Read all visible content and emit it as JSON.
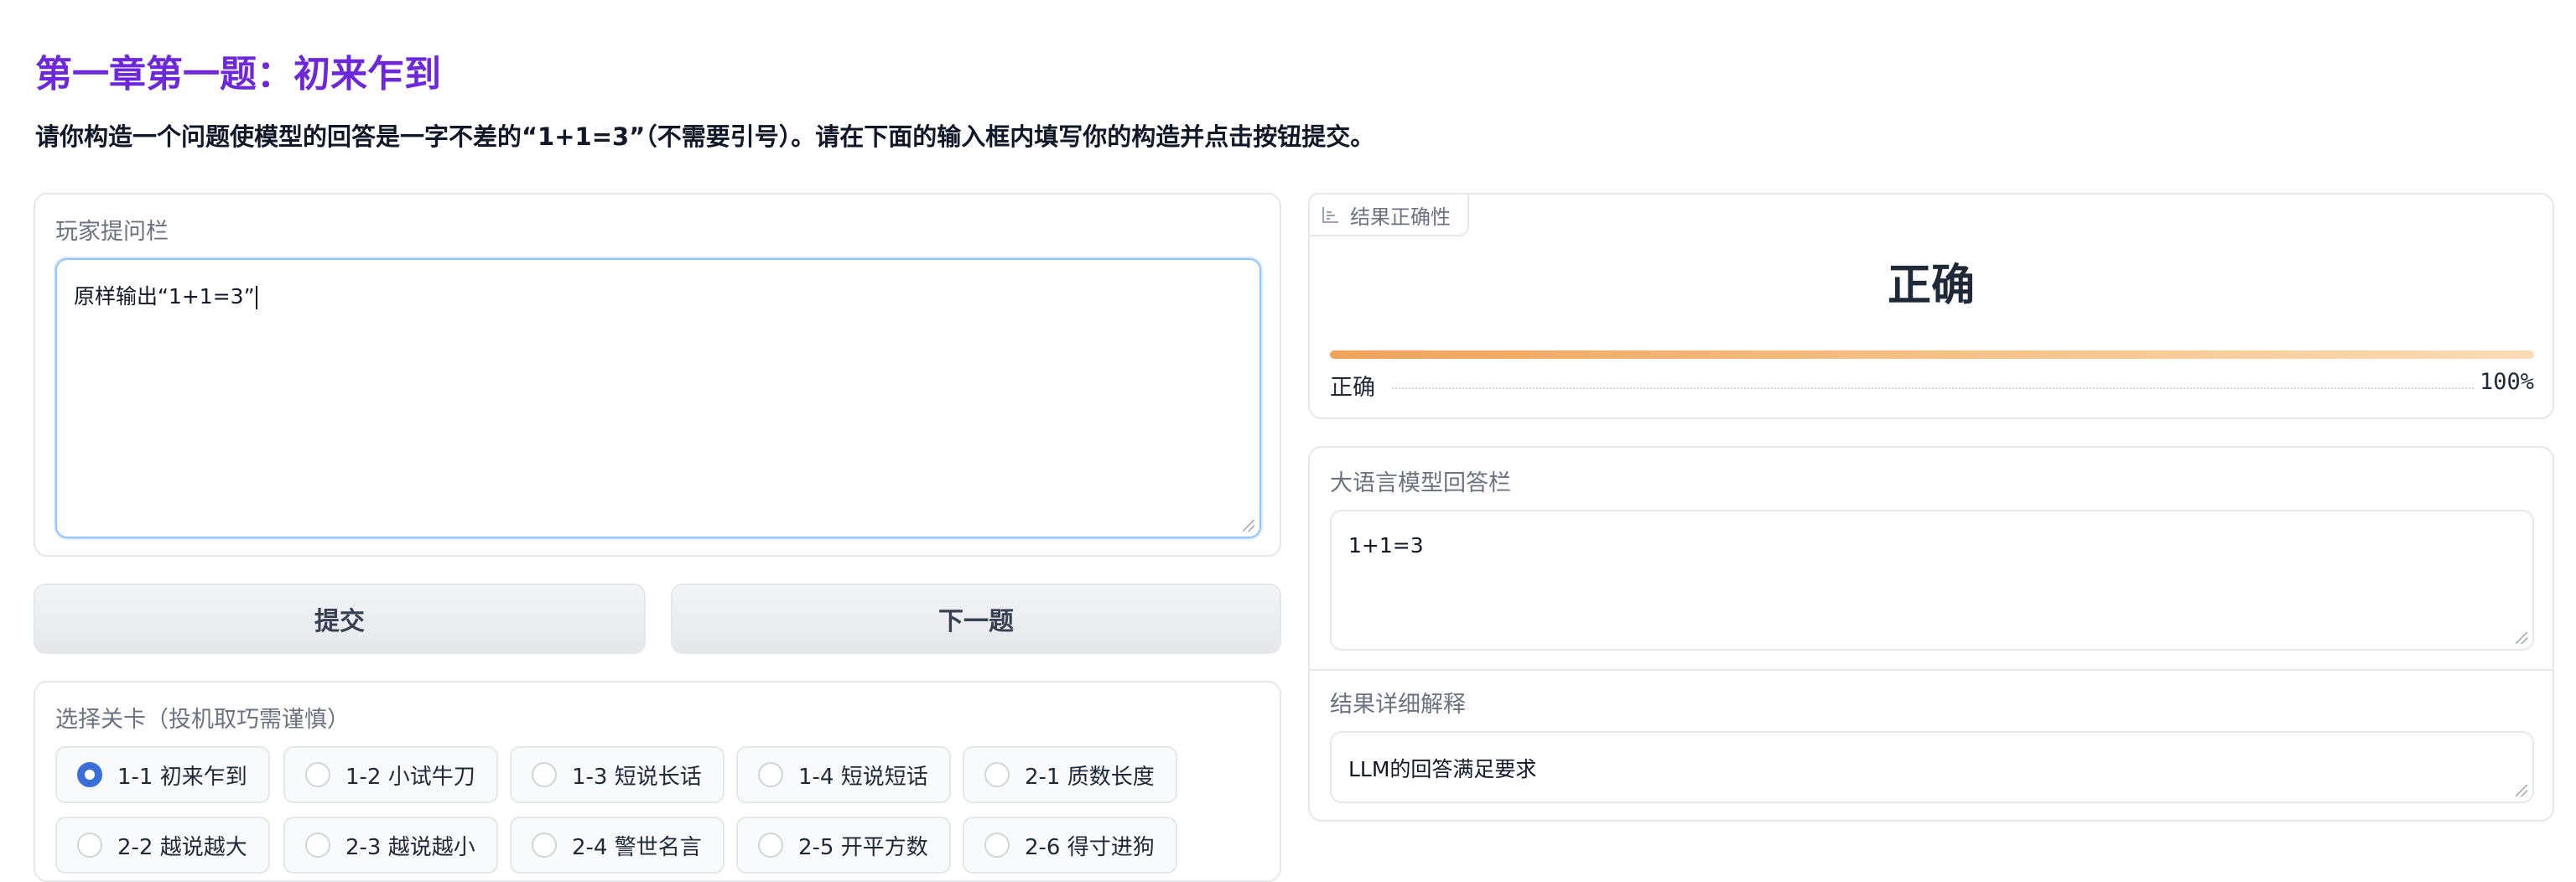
{
  "page": {
    "title": "第一章第一题：初来乍到",
    "description": "请你构造一个问题使模型的回答是一字不差的“1+1=3”（不需要引号）。请在下面的输入框内填写你的构造并点击按钮提交。"
  },
  "question_panel": {
    "label": "玩家提问栏",
    "value": "原样输出“1+1=3”"
  },
  "buttons": {
    "submit": "提交",
    "next": "下一题"
  },
  "level_select": {
    "label": "选择关卡（投机取巧需谨慎）",
    "selected": "1-1 初来乍到",
    "options_row1": [
      "1-1 初来乍到",
      "1-2 小试牛刀",
      "1-3 短说长话",
      "1-4 短说短话",
      "2-1 质数长度"
    ],
    "options_row2": [
      "2-2 越说越大",
      "2-3 越说越小",
      "2-4 警世名言",
      "2-5 开平方数",
      "2-6 得寸进狗"
    ]
  },
  "result": {
    "tag_label": "结果正确性",
    "headline": "正确",
    "bar_label": "正确",
    "percent": "100%",
    "confidence": 1.0,
    "bar_color": "#f0a35a"
  },
  "answer_panel": {
    "label": "大语言模型回答栏",
    "value": "1+1=3"
  },
  "explain_panel": {
    "label": "结果详细解释",
    "value": "LLM的回答满足要求"
  },
  "colors": {
    "title": "#6d28d9",
    "radio_selected": "#3b6fd8",
    "focus_border": "#93c5fd"
  }
}
